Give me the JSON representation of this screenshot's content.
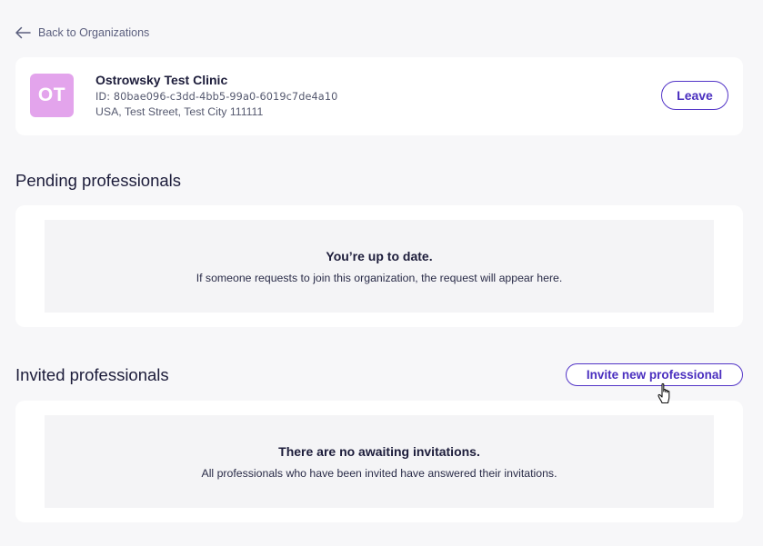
{
  "nav": {
    "back_label": "Back to Organizations",
    "back_icon": "arrow-left-icon"
  },
  "organization": {
    "initials": "OT",
    "avatar_color": "#e3a4ec",
    "name": "Ostrowsky Test Clinic",
    "id_line": "ID: 80bae096-c3dd-4bb5-99a0-6019c7de4a10",
    "address": "USA, Test Street, Test City 111111",
    "leave_label": "Leave"
  },
  "pending": {
    "title": "Pending professionals",
    "empty_title": "You’re up to date.",
    "empty_text": "If someone requests to join this organization, the request will appear here."
  },
  "invited": {
    "title": "Invited professionals",
    "invite_label": "Invite new professional",
    "empty_title": "There are no awaiting invitations.",
    "empty_text": "All professionals who have been invited have answered their invitations."
  },
  "colors": {
    "accent": "#5234c7",
    "page_bg": "#f7f7f9",
    "card_bg": "#ffffff",
    "empty_bg": "#f4f4f6"
  },
  "cursor_icon": "hand-pointer-icon"
}
